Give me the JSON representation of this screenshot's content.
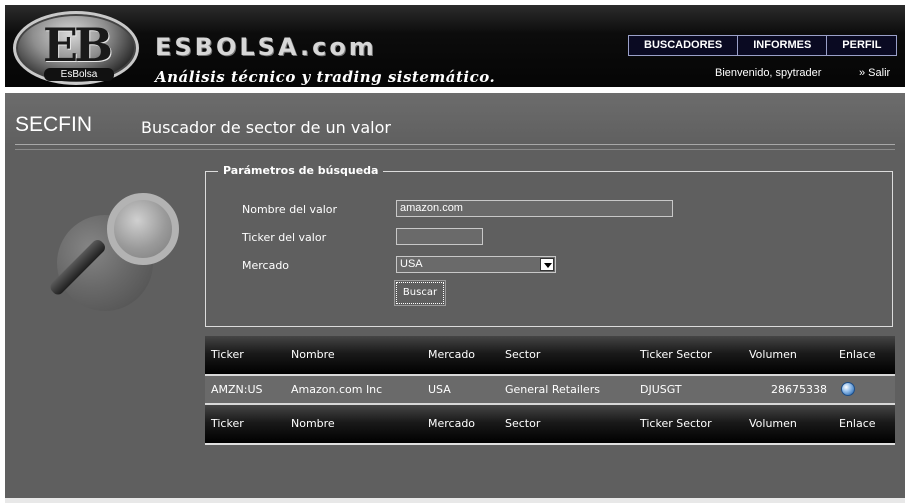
{
  "header": {
    "logo_letters": "EB",
    "logo_sub": "EsBolsa",
    "brand": "ESBOLSA.com",
    "tagline": "Análisis técnico y trading sistemático.",
    "nav": [
      "BUSCADORES",
      "INFORMES",
      "PERFIL"
    ],
    "welcome": "Bienvenido, spytrader",
    "logout": "» Salir"
  },
  "page": {
    "code": "SECFIN",
    "title": "Buscador de sector de un valor",
    "decor_icon": "globe-magnifier-icon"
  },
  "form": {
    "legend": "Parámetros de búsqueda",
    "name_label": "Nombre del valor",
    "name_value": "amazon.com",
    "ticker_label": "Ticker del valor",
    "ticker_value": "",
    "market_label": "Mercado",
    "market_value": "USA",
    "search_button": "Buscar"
  },
  "table": {
    "columns": [
      "Ticker",
      "Nombre",
      "Mercado",
      "Sector",
      "Ticker Sector",
      "Volumen",
      "Enlace"
    ],
    "rows": [
      {
        "ticker": "AMZN:US",
        "name": "Amazon.com Inc",
        "market": "USA",
        "sector": "General Retailers",
        "sector_ticker": "DJUSGT",
        "volume": "28675338",
        "link_icon": "globe-link-icon"
      }
    ]
  },
  "colors": {
    "header_bg": "#050505",
    "page_bg": "#5f5f5f",
    "nav_button_bg": "#0a0a22",
    "table_header_bg": "#000000"
  }
}
